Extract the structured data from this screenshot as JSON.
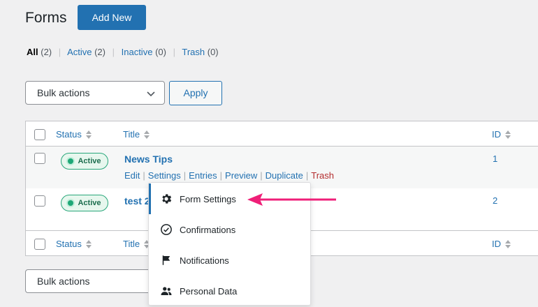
{
  "header": {
    "title": "Forms",
    "add_new_label": "Add New"
  },
  "filters": {
    "all": "All",
    "all_count": "(2)",
    "active": "Active",
    "active_count": "(2)",
    "inactive": "Inactive",
    "inactive_count": "(0)",
    "trash": "Trash",
    "trash_count": "(0)",
    "separator": "|"
  },
  "bulk": {
    "label": "Bulk actions",
    "apply_label": "Apply"
  },
  "table": {
    "columns": {
      "status": "Status",
      "title": "Title",
      "id": "ID"
    },
    "rows": [
      {
        "status": "Active",
        "title": "News Tips",
        "id": "1",
        "actions": [
          "Edit",
          "Settings",
          "Entries",
          "Preview",
          "Duplicate",
          "Trash"
        ]
      },
      {
        "status": "Active",
        "title": "test 2",
        "id": "2"
      }
    ]
  },
  "settings_menu": {
    "items": [
      {
        "label": "Form Settings",
        "icon": "gear-icon"
      },
      {
        "label": "Confirmations",
        "icon": "check-circle-icon"
      },
      {
        "label": "Notifications",
        "icon": "flag-icon"
      },
      {
        "label": "Personal Data",
        "icon": "users-icon"
      }
    ]
  },
  "colors": {
    "accent": "#2271b1",
    "active_badge": "#1ea877",
    "trash": "#b32d2e",
    "arrow": "#ef1f78"
  }
}
